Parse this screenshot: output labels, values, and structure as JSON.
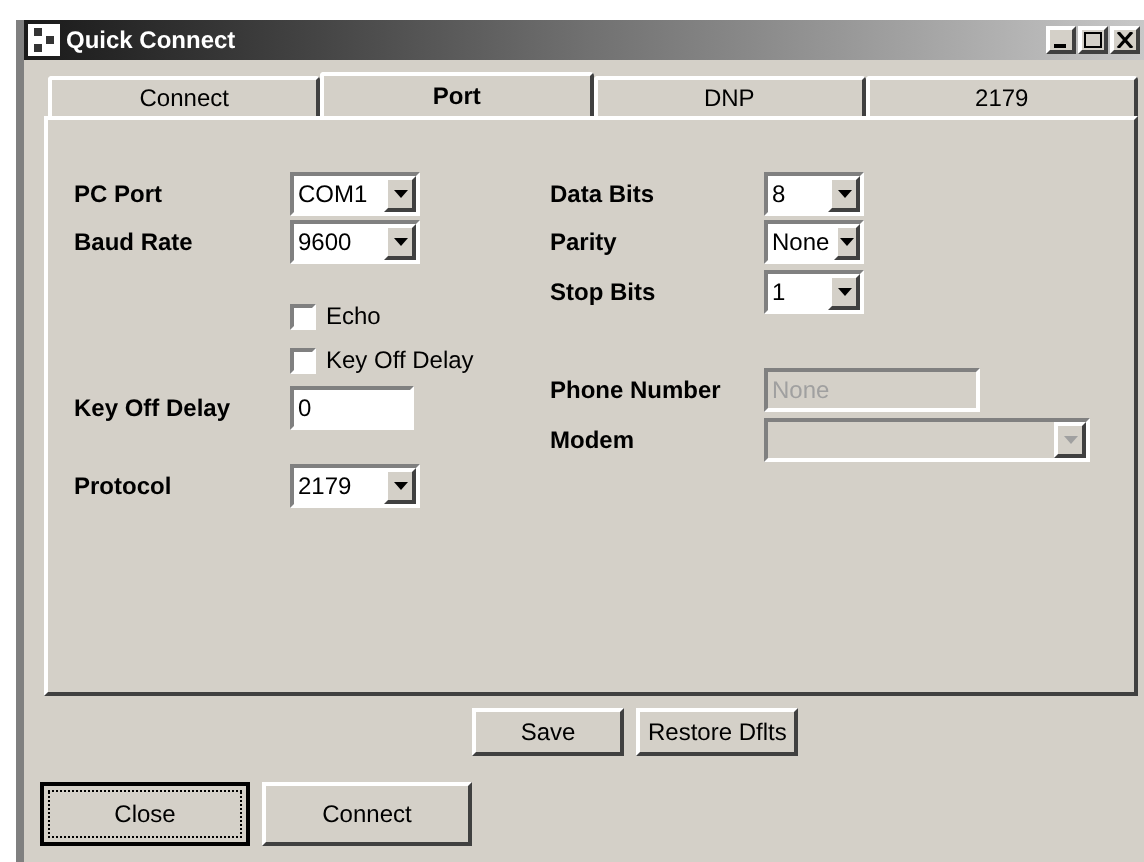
{
  "window": {
    "title": "Quick Connect"
  },
  "tabs": [
    {
      "label": "Connect",
      "selected": false
    },
    {
      "label": "Port",
      "selected": true
    },
    {
      "label": "DNP",
      "selected": false
    },
    {
      "label": "2179",
      "selected": false
    }
  ],
  "left_fields": [
    {
      "kind": "combo",
      "label": "PC Port",
      "value": "COM1",
      "disabled": false
    },
    {
      "kind": "combo",
      "label": "Baud Rate",
      "value": "9600",
      "disabled": false
    },
    {
      "kind": "checkbox",
      "label": "Echo",
      "checked": false
    },
    {
      "kind": "checkbox",
      "label": "Key Off Delay",
      "checked": false
    },
    {
      "kind": "text",
      "label": "Key Off Delay",
      "value": "0",
      "disabled": false
    },
    {
      "kind": "combo",
      "label": "Protocol",
      "value": "2179",
      "disabled": false
    }
  ],
  "right_fields": [
    {
      "kind": "combo",
      "label": "Data Bits",
      "value": "8",
      "disabled": false
    },
    {
      "kind": "combo",
      "label": "Parity",
      "value": "None",
      "disabled": false
    },
    {
      "kind": "combo",
      "label": "Stop Bits",
      "value": "1",
      "disabled": false
    },
    {
      "kind": "text",
      "label": "Phone Number",
      "placeholder": "None",
      "disabled": true
    },
    {
      "kind": "combo",
      "label": "Modem",
      "disabled": true
    }
  ],
  "panel_buttons": [
    "Save",
    "Restore Dflts"
  ],
  "footer_buttons": [
    {
      "label": "Close",
      "default": true
    },
    {
      "label": "Connect",
      "default": false
    }
  ]
}
